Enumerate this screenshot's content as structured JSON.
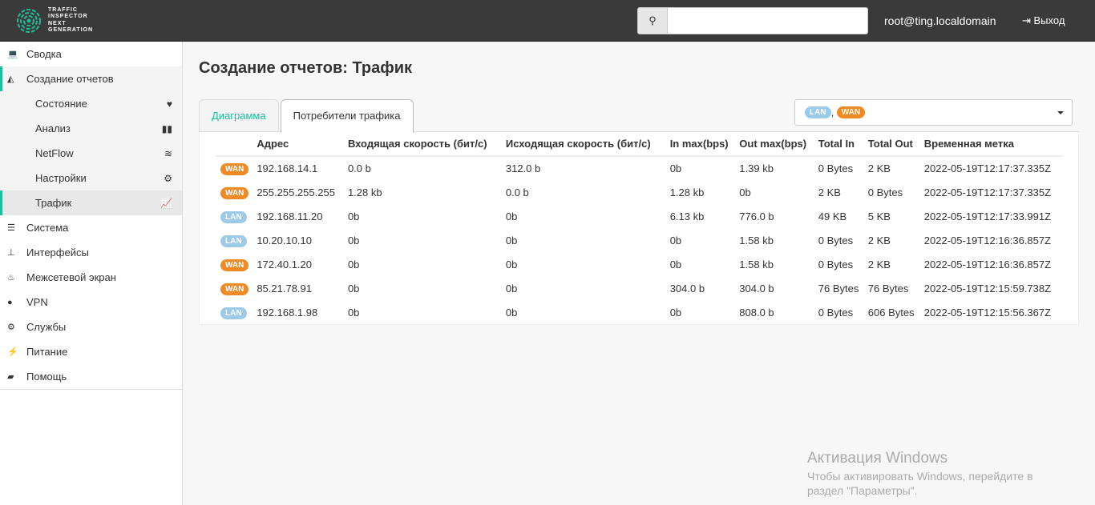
{
  "header": {
    "logo_text": [
      "TRAFFIC",
      "INSPECTOR",
      "NEXT",
      "GENERATION"
    ],
    "search_placeholder": "",
    "user": "root@ting.localdomain",
    "logout": "Выход"
  },
  "sidebar": {
    "items": [
      {
        "label": "Сводка",
        "icon": "laptop-icon",
        "glyph": "💻"
      },
      {
        "label": "Создание отчетов",
        "icon": "area-chart-icon",
        "glyph": "◭"
      }
    ],
    "sub": [
      {
        "label": "Состояние",
        "icon": "heartbeat-icon",
        "glyph": "♥"
      },
      {
        "label": "Анализ",
        "icon": "binoculars-icon",
        "glyph": "▮▮"
      },
      {
        "label": "NetFlow",
        "icon": "rss-icon",
        "glyph": "≋"
      },
      {
        "label": "Настройки",
        "icon": "cog-icon",
        "glyph": "⚙"
      },
      {
        "label": "Трафик",
        "icon": "line-chart-icon",
        "glyph": "📈"
      }
    ],
    "rest": [
      {
        "label": "Система",
        "icon": "server-icon",
        "glyph": "☰"
      },
      {
        "label": "Интерфейсы",
        "icon": "sitemap-icon",
        "glyph": "⊥"
      },
      {
        "label": "Межсетевой экран",
        "icon": "fire-icon",
        "glyph": "♨"
      },
      {
        "label": "VPN",
        "icon": "globe-icon",
        "glyph": "●"
      },
      {
        "label": "Службы",
        "icon": "cogs-icon",
        "glyph": "⚙"
      },
      {
        "label": "Питание",
        "icon": "plug-icon",
        "glyph": "⚡"
      },
      {
        "label": "Помощь",
        "icon": "book-icon",
        "glyph": "▰"
      }
    ]
  },
  "main": {
    "title": "Создание отчетов: Трафик",
    "tabs": [
      {
        "label": "Диаграмма"
      },
      {
        "label": "Потребители трафика"
      }
    ],
    "filter": {
      "selected": [
        "LAN",
        "WAN"
      ]
    },
    "table": {
      "headers": [
        "",
        "Адрес",
        "Входящая скорость (бит/с)",
        "Исходящая скорость (бит/с)",
        "In max(bps)",
        "Out max(bps)",
        "Total In",
        "Total Out",
        "Временная метка"
      ],
      "rows": [
        [
          "WAN",
          "192.168.14.1",
          "0.0 b",
          "312.0 b",
          "0b",
          "1.39 kb",
          "0 Bytes",
          "2 KB",
          "2022-05-19T12:17:37.335Z"
        ],
        [
          "WAN",
          "255.255.255.255",
          "1.28 kb",
          "0.0 b",
          "1.28 kb",
          "0b",
          "2 KB",
          "0 Bytes",
          "2022-05-19T12:17:37.335Z"
        ],
        [
          "LAN",
          "192.168.11.20",
          "0b",
          "0b",
          "6.13 kb",
          "776.0 b",
          "49 KB",
          "5 KB",
          "2022-05-19T12:17:33.991Z"
        ],
        [
          "LAN",
          "10.20.10.10",
          "0b",
          "0b",
          "0b",
          "1.58 kb",
          "0 Bytes",
          "2 KB",
          "2022-05-19T12:16:36.857Z"
        ],
        [
          "WAN",
          "172.40.1.20",
          "0b",
          "0b",
          "0b",
          "1.58 kb",
          "0 Bytes",
          "2 KB",
          "2022-05-19T12:16:36.857Z"
        ],
        [
          "WAN",
          "85.21.78.91",
          "0b",
          "0b",
          "304.0 b",
          "304.0 b",
          "76 Bytes",
          "76 Bytes",
          "2022-05-19T12:15:59.738Z"
        ],
        [
          "LAN",
          "192.168.1.98",
          "0b",
          "0b",
          "0b",
          "808.0 b",
          "0 Bytes",
          "606 Bytes",
          "2022-05-19T12:15:56.367Z"
        ]
      ]
    }
  },
  "watermark": {
    "title": "Активация Windows",
    "line1": "Чтобы активировать Windows, перейдите в",
    "line2": "раздел \"Параметры\"."
  }
}
